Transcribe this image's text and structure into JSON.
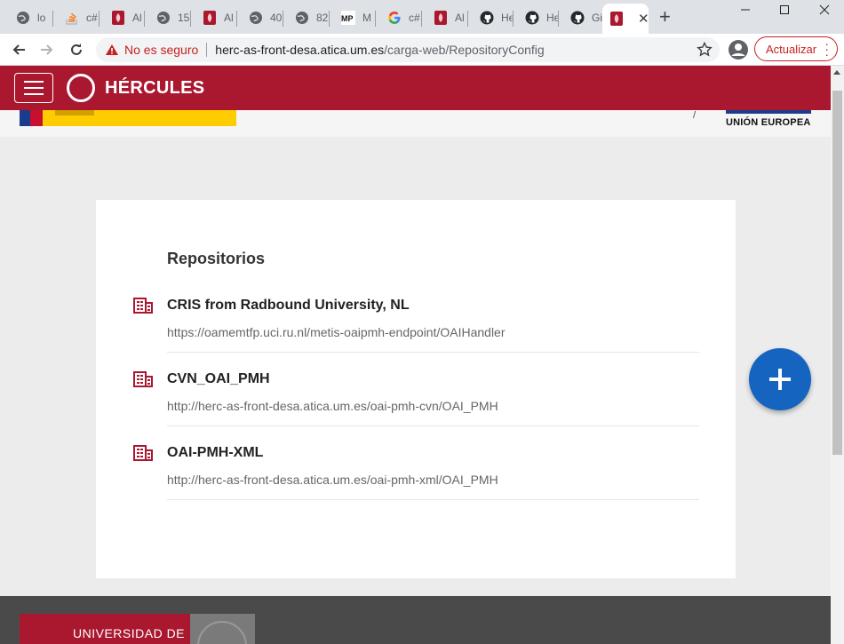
{
  "browser": {
    "tabs": [
      {
        "icon": "globe-icon",
        "title": "lo"
      },
      {
        "icon": "stackoverflow-icon",
        "title": "c#"
      },
      {
        "icon": "um-icon",
        "title": "Al"
      },
      {
        "icon": "globe-icon",
        "title": "15"
      },
      {
        "icon": "um-icon",
        "title": "Al"
      },
      {
        "icon": "globe-icon",
        "title": "40"
      },
      {
        "icon": "globe-icon",
        "title": "82"
      },
      {
        "icon": "mp-icon",
        "title": "M"
      },
      {
        "icon": "google-icon",
        "title": "c#"
      },
      {
        "icon": "um-icon",
        "title": "Al"
      },
      {
        "icon": "github-icon",
        "title": "He"
      },
      {
        "icon": "github-icon",
        "title": "He"
      },
      {
        "icon": "github-icon",
        "title": "Gi"
      }
    ],
    "active_tab_icon": "um-icon",
    "mp_label": "MP",
    "security_label": "No es seguro",
    "url_host": "herc-as-front-desa.atica.um.es",
    "url_path": "/carga-web/RepositoryConfig",
    "update_label": "Actualizar",
    "accent_color": "#c5221f"
  },
  "app": {
    "name": "HÉRCULES",
    "brand_color": "#aa1830",
    "eu_label": "UNIÓN EUROPEA",
    "slash": "/"
  },
  "main": {
    "title": "Repositorios",
    "repositories": [
      {
        "name": "CRIS from Radbound University, NL",
        "url": "https://oamemtfp.uci.ru.nl/metis-oaipmh-endpoint/OAIHandler"
      },
      {
        "name": "CVN_OAI_PMH",
        "url": "http://herc-as-front-desa.atica.um.es/oai-pmh-cvn/OAI_PMH"
      },
      {
        "name": "OAI-PMH-XML",
        "url": "http://herc-as-front-desa.atica.um.es/oai-pmh-xml/OAI_PMH"
      }
    ],
    "add_icon": "plus-icon",
    "fab_color": "#1565c0"
  },
  "footer": {
    "university_label": "UNIVERSIDAD DE"
  }
}
